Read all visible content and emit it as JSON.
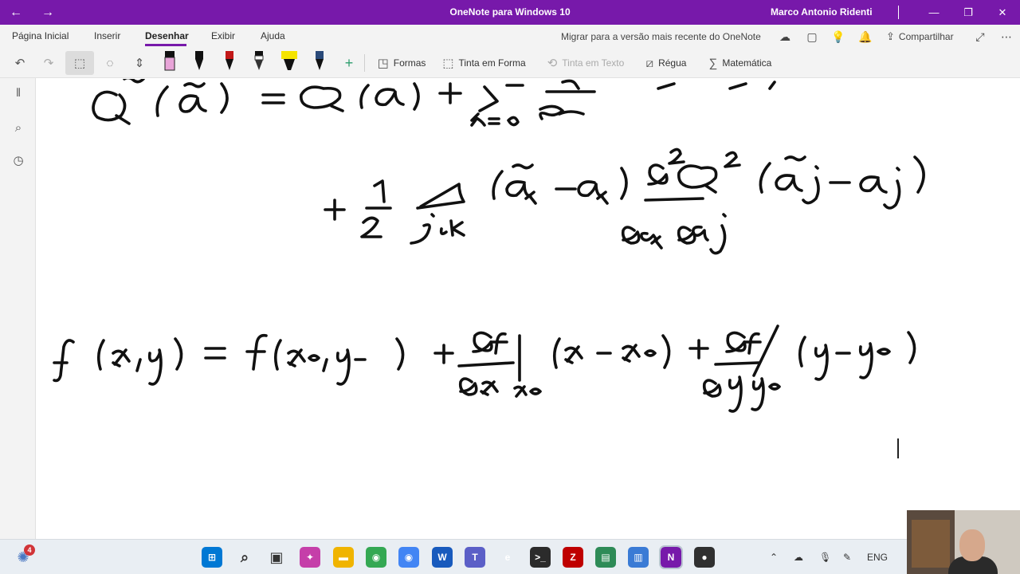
{
  "titlebar": {
    "title": "OneNote para Windows 10",
    "user": "Marco Antonio Ridenti",
    "back_glyph": "←",
    "forward_glyph": "→",
    "minimize_glyph": "—",
    "restore_glyph": "❐",
    "close_glyph": "✕"
  },
  "ribbon_tabs": [
    "Página Inicial",
    "Inserir",
    "Desenhar",
    "Exibir",
    "Ajuda"
  ],
  "active_tab": "Desenhar",
  "ribbon_right": {
    "migrate_label": "Migrar para a versão mais recente do OneNote",
    "share_label": "Compartilhar"
  },
  "toolbar": {
    "shapes_label": "Formas",
    "ink_to_shape_label": "Tinta em Forma",
    "ink_to_text_label": "Tinta em Texto",
    "ruler_label": "Régua",
    "math_label": "Matemática"
  },
  "pens": [
    {
      "name": "eraser",
      "color": "#e8a4d8"
    },
    {
      "name": "black-pen",
      "color": "#111111"
    },
    {
      "name": "red-pen",
      "color": "#c21818"
    },
    {
      "name": "black-pencil",
      "color": "#333333"
    },
    {
      "name": "yellow-highlighter",
      "color": "#f5e400"
    },
    {
      "name": "galaxy-pen",
      "color": "#2a4a7a"
    }
  ],
  "accent_color": "#7719aa",
  "taskbar": {
    "notification_count": "4",
    "language": "ENG",
    "apps": [
      {
        "name": "start",
        "glyph": "⊞",
        "color": "#0078d4"
      },
      {
        "name": "search",
        "glyph": "⌕",
        "color": "#333333"
      },
      {
        "name": "task-view",
        "glyph": "▣",
        "color": "#333333"
      },
      {
        "name": "copilot",
        "glyph": "✦",
        "color": "#c53fa9"
      },
      {
        "name": "file-explorer",
        "glyph": "▬",
        "color": "#f0b400"
      },
      {
        "name": "chrome",
        "glyph": "◉",
        "color": "#34a853"
      },
      {
        "name": "chrome-profile",
        "glyph": "◉",
        "color": "#4285f4"
      },
      {
        "name": "word",
        "glyph": "W",
        "color": "#185abd"
      },
      {
        "name": "teams",
        "glyph": "T",
        "color": "#5b5fc7"
      },
      {
        "name": "app-e",
        "glyph": "e",
        "color": "#7b3fb5"
      },
      {
        "name": "terminal",
        "glyph": ">_",
        "color": "#2b2b2b"
      },
      {
        "name": "filezilla",
        "glyph": "Z",
        "color": "#bf0000"
      },
      {
        "name": "spreadsheet",
        "glyph": "▤",
        "color": "#2e8b57"
      },
      {
        "name": "notepad",
        "glyph": "▥",
        "color": "#3a7bd5"
      },
      {
        "name": "onenote",
        "glyph": "N",
        "color": "#7719aa"
      },
      {
        "name": "obs",
        "glyph": "●",
        "color": "#303030"
      }
    ]
  }
}
